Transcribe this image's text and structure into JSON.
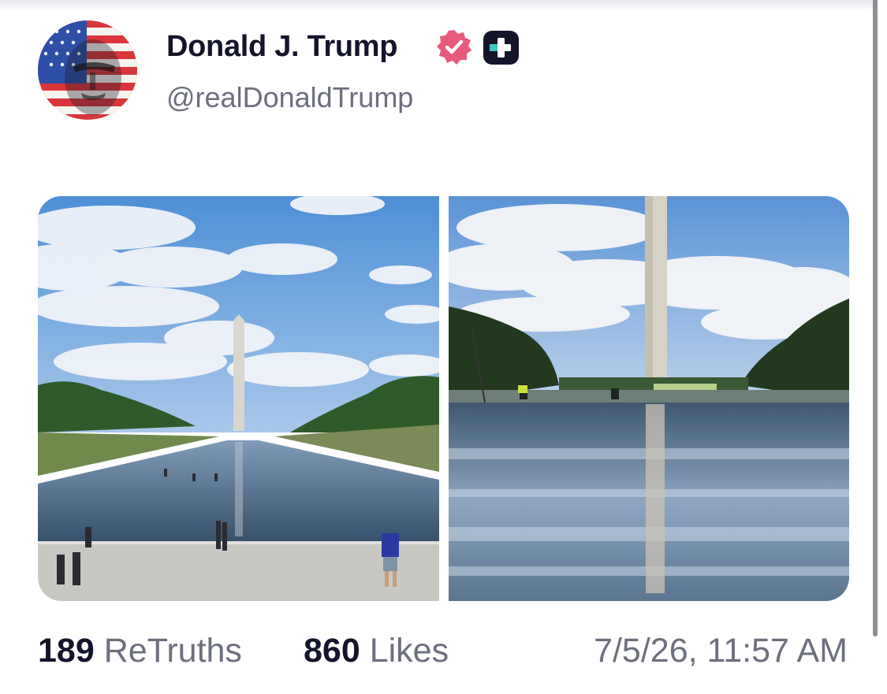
{
  "post": {
    "author": {
      "display_name": "Donald J. Trump",
      "handle": "@realDonaldTrump",
      "verified_icon": "verified-badge-icon",
      "extra_badge_icon": "plus-badge-icon"
    },
    "media": [
      {
        "description_icon": "photo-reflecting-pool-wide"
      },
      {
        "description_icon": "photo-reflecting-pool-closeup"
      }
    ],
    "stats": {
      "retruths_count": "189",
      "retruths_label": "ReTruths",
      "likes_count": "860",
      "likes_label": "Likes"
    },
    "timestamp": "7/5/26, 11:57 AM"
  },
  "colors": {
    "name_text": "#14142b",
    "secondary_text": "#6c6f7d",
    "verified_badge": "#e85a7b",
    "scrollbar": "#8e8e93"
  }
}
